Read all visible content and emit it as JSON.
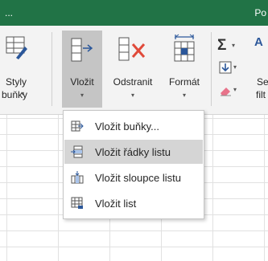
{
  "title_bar": {
    "left_text": "...",
    "right_text": "Po"
  },
  "ribbon": {
    "styly_bunky": {
      "line1": "Styly",
      "line2": "buňky",
      "caret": "▾"
    },
    "vlozit": {
      "label": "Vložit",
      "caret": "▾"
    },
    "odstranit": {
      "label": "Odstranit",
      "caret": "▾"
    },
    "format": {
      "label": "Formát",
      "caret": "▾"
    },
    "autosum_caret": "▾",
    "fill_caret": "▾",
    "clear_caret": "▾",
    "sort_partial": {
      "line1": "Se",
      "line2": "filt"
    }
  },
  "insert_menu": {
    "items": [
      {
        "label": "Vložit buňky...",
        "icon": "insert-cells-icon"
      },
      {
        "label": "Vložit řádky listu",
        "icon": "insert-rows-icon",
        "highlighted": true
      },
      {
        "label": "Vložit sloupce listu",
        "icon": "insert-columns-icon"
      },
      {
        "label": "Vložit list",
        "icon": "insert-sheet-icon"
      }
    ]
  },
  "colors": {
    "excel_green": "#217346",
    "ribbon_bg": "#f3f3f3",
    "active_button": "#c5c5c5",
    "menu_highlight": "#d5d5d5"
  }
}
